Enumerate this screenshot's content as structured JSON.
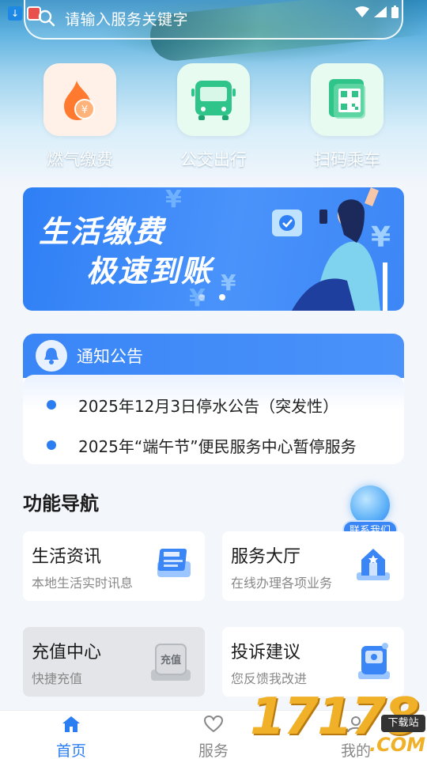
{
  "search": {
    "placeholder": "请输入服务关键字"
  },
  "quick_actions": [
    {
      "label": "燃气缴费",
      "icon": "gas-flame-icon"
    },
    {
      "label": "公交出行",
      "icon": "bus-icon"
    },
    {
      "label": "扫码乘车",
      "icon": "qr-code-icon"
    }
  ],
  "banner": {
    "line1": "生活缴费",
    "line2": "极速到账"
  },
  "notice": {
    "title": "通知公告",
    "items": [
      "2025年12月3日停水公告（突发性）",
      "2025年“端午节”便民服务中心暂停服务"
    ]
  },
  "nav": {
    "title": "功能导航",
    "contact_label": "联系我们",
    "cards": [
      {
        "title": "生活资讯",
        "subtitle": "本地生活实时讯息",
        "icon": "news-icon"
      },
      {
        "title": "服务大厅",
        "subtitle": "在线办理各项业务",
        "icon": "service-hall-icon"
      },
      {
        "title": "充值中心",
        "subtitle": "快捷充值",
        "icon": "recharge-icon",
        "badge": "充值"
      },
      {
        "title": "投诉建议",
        "subtitle": "您反馈我改进",
        "icon": "mailbox-icon"
      }
    ]
  },
  "tabs": [
    {
      "label": "首页",
      "active": true
    },
    {
      "label": "服务",
      "active": false
    },
    {
      "label": "我的",
      "active": false
    }
  ],
  "watermark": {
    "number": "17178",
    "tag": "下载站",
    "suffix": ".COM"
  },
  "colors": {
    "primary": "#2b7ef2",
    "banner": "#3c86f6"
  }
}
